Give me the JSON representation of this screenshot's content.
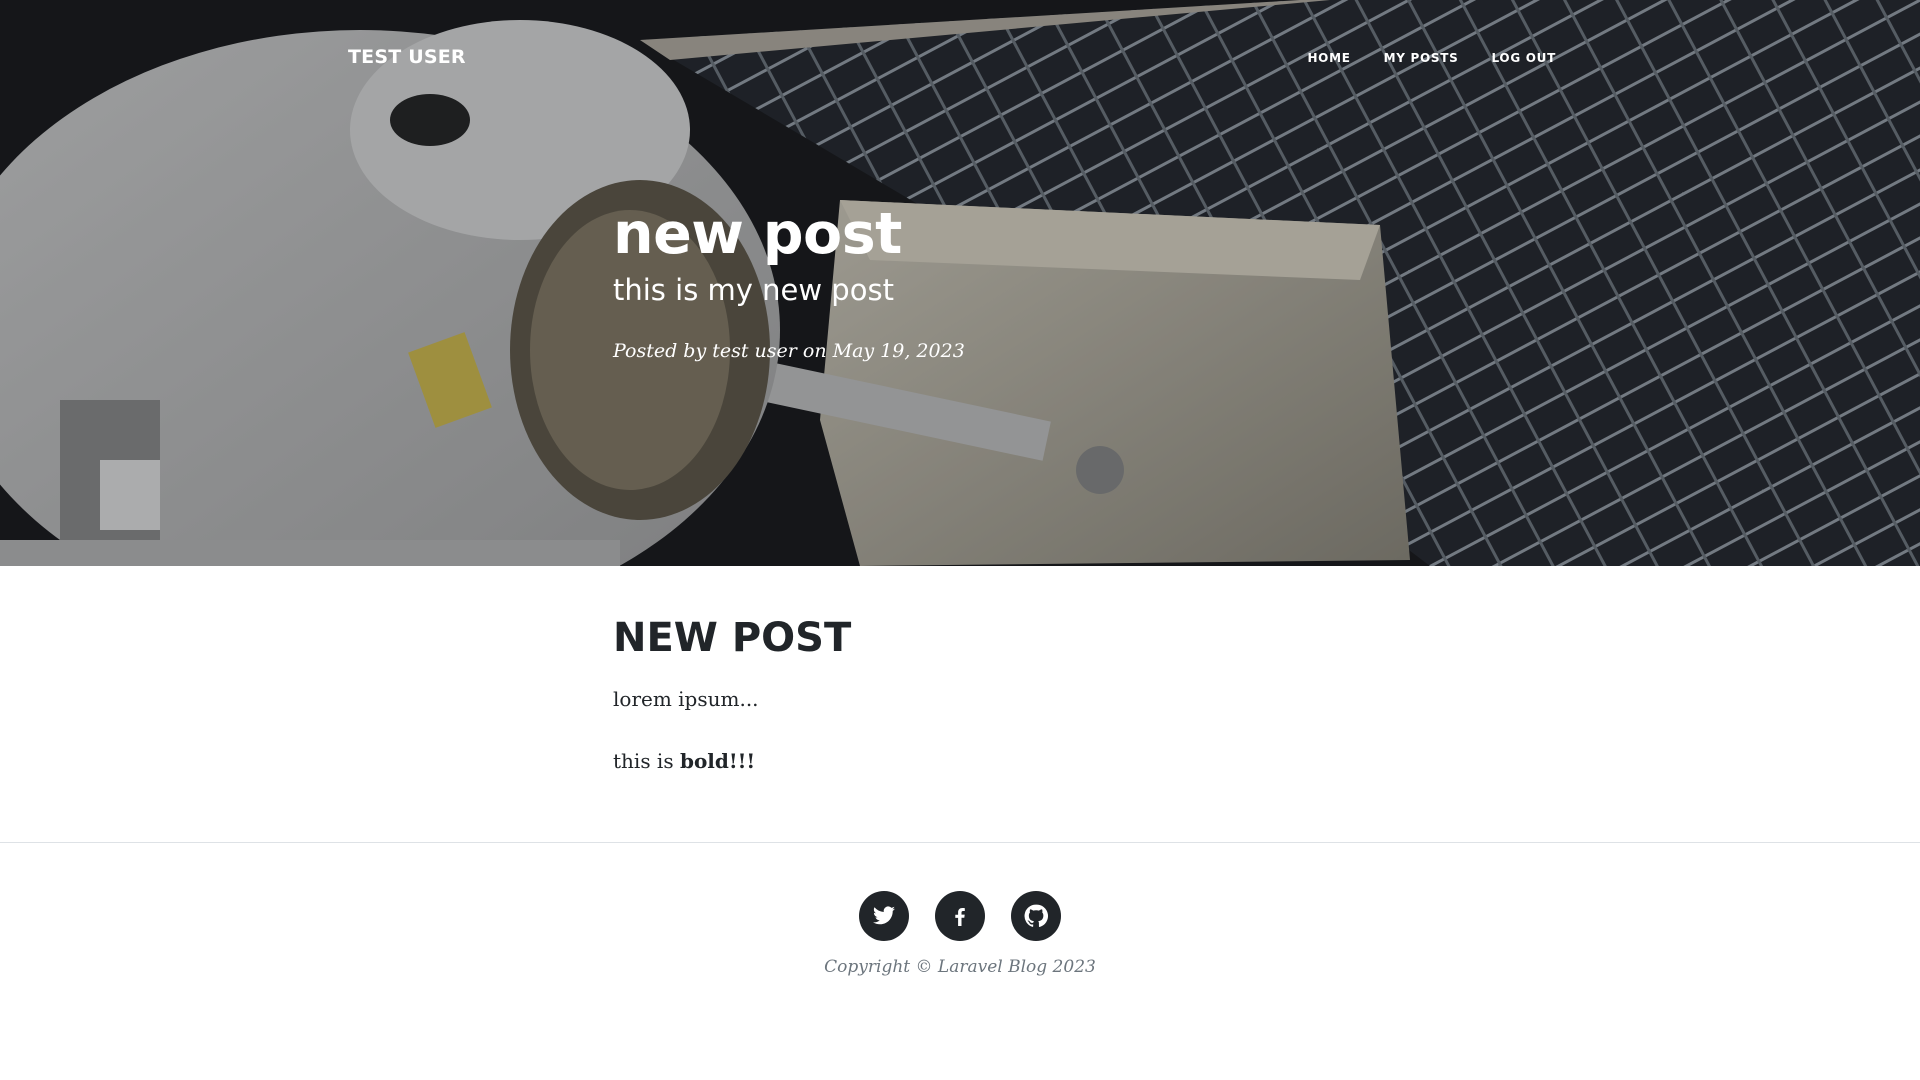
{
  "navbar": {
    "brand": "TEST USER",
    "links": [
      {
        "label": "HOME"
      },
      {
        "label": "MY POSTS"
      },
      {
        "label": "LOG OUT"
      }
    ]
  },
  "hero": {
    "title": "new post",
    "subtitle": "this is my new post",
    "meta": {
      "prefix": "Posted by ",
      "author": "test user",
      "middle": " on ",
      "date": "May 19, 2023"
    }
  },
  "article": {
    "heading": "NEW POST",
    "paragraph_1": "lorem ipsum...",
    "paragraph_2_prefix": "this is ",
    "paragraph_2_bold": "bold!!!"
  },
  "footer": {
    "social": [
      {
        "icon": "twitter-icon"
      },
      {
        "icon": "facebook-icon"
      },
      {
        "icon": "github-icon"
      }
    ],
    "copyright": "Copyright © Laravel Blog 2023"
  },
  "colors": {
    "text_dark": "#212529",
    "muted": "#6c757d",
    "divider": "#dee2e6",
    "hero_overlay": "#212529"
  }
}
